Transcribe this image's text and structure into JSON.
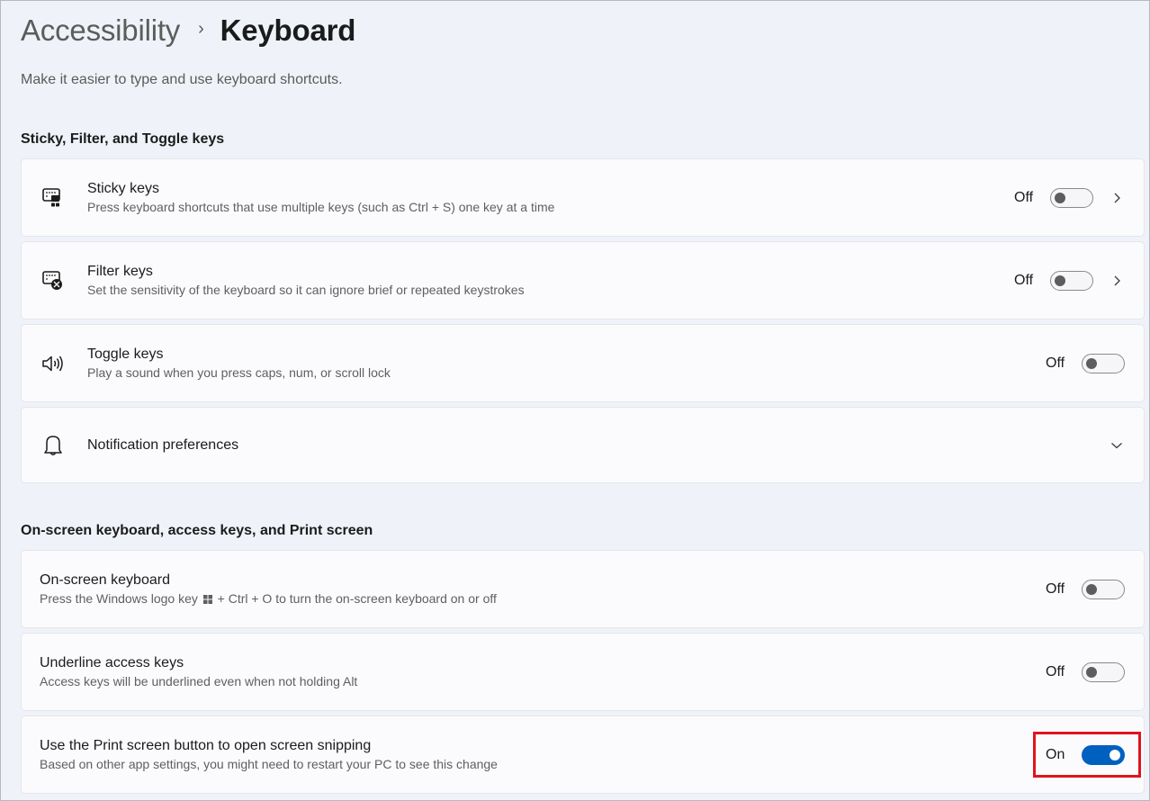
{
  "header": {
    "breadcrumb_parent": "Accessibility",
    "breadcrumb_separator": "›",
    "breadcrumb_current": "Keyboard",
    "description": "Make it easier to type and use keyboard shortcuts."
  },
  "sections": [
    {
      "title": "Sticky, Filter, and Toggle keys",
      "items": [
        {
          "icon": "sticky-keys-icon",
          "title": "Sticky keys",
          "subtitle": "Press keyboard shortcuts that use multiple keys (such as Ctrl + S) one key at a time",
          "state": "Off",
          "toggle_on": false,
          "chevron": "right"
        },
        {
          "icon": "filter-keys-icon",
          "title": "Filter keys",
          "subtitle": "Set the sensitivity of the keyboard so it can ignore brief or repeated keystrokes",
          "state": "Off",
          "toggle_on": false,
          "chevron": "right"
        },
        {
          "icon": "speaker-icon",
          "title": "Toggle keys",
          "subtitle": "Play a sound when you press caps, num, or scroll lock",
          "state": "Off",
          "toggle_on": false
        },
        {
          "icon": "bell-icon",
          "title": "Notification preferences",
          "chevron": "down"
        }
      ]
    },
    {
      "title": "On-screen keyboard, access keys, and Print screen",
      "items": [
        {
          "title": "On-screen keyboard",
          "subtitle_before_logo": "Press the Windows logo key",
          "subtitle_after_logo": " + Ctrl + O to turn the on-screen keyboard on or off",
          "state": "Off",
          "toggle_on": false
        },
        {
          "title": "Underline access keys",
          "subtitle": "Access keys will be underlined even when not holding Alt",
          "state": "Off",
          "toggle_on": false
        },
        {
          "title": "Use the Print screen button to open screen snipping",
          "subtitle": "Based on other app settings, you might need to restart your PC to see this change",
          "state": "On",
          "toggle_on": true,
          "highlighted": true
        }
      ]
    }
  ],
  "colors": {
    "accent": "#0060c0",
    "highlight": "#e0141e",
    "background": "#eff3f9",
    "card": "#fbfbfd"
  }
}
